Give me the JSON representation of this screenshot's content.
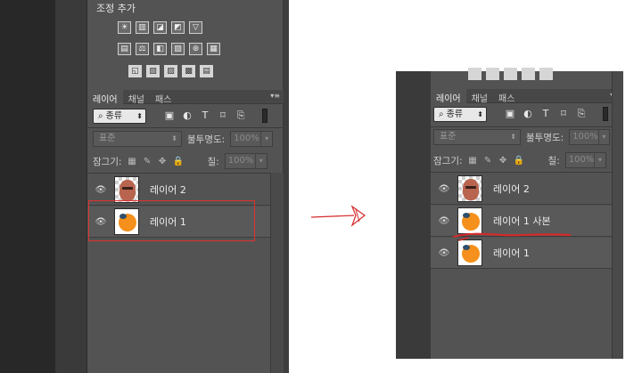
{
  "left": {
    "adjustments_title": "조정 추가",
    "adjust_rows": [
      [
        "☀",
        "▥",
        "◪",
        "◩",
        "▽"
      ],
      [
        "▤",
        "⚖",
        "◧",
        "▨",
        "⊛",
        "▦"
      ],
      [
        "◱",
        "▧",
        "▨",
        "▩",
        "▤"
      ]
    ],
    "tabs": [
      "레이어",
      "채널",
      "패스"
    ],
    "filter_kind": "종류",
    "blend_mode": "표준",
    "opacity_label": "불투명도:",
    "opacity_value": "100%",
    "lock_label": "잠그기:",
    "fill_label": "칠:",
    "fill_value": "100%",
    "layers": [
      {
        "name": "레이어 2",
        "thumb": "face"
      },
      {
        "name": "레이어 1",
        "thumb": "orange"
      }
    ]
  },
  "right": {
    "tabs": [
      "레이어",
      "채널",
      "패스"
    ],
    "filter_kind": "종류",
    "blend_mode": "표준",
    "opacity_label": "불투명도:",
    "opacity_value": "100%",
    "lock_label": "잠그기:",
    "fill_label": "칠:",
    "fill_value": "100%",
    "layers": [
      {
        "name": "레이어 2",
        "thumb": "face"
      },
      {
        "name": "레이어 1 사본",
        "thumb": "orange"
      },
      {
        "name": "레이어 1",
        "thumb": "orange"
      }
    ]
  },
  "icons": {
    "search": "⌕",
    "dropdown": "⬍",
    "eye": "👁",
    "menu": "▾≡"
  },
  "colors": {
    "highlight_rect": "#e03030",
    "annotation": "#d42a2a",
    "panel_bg": "#535353"
  }
}
